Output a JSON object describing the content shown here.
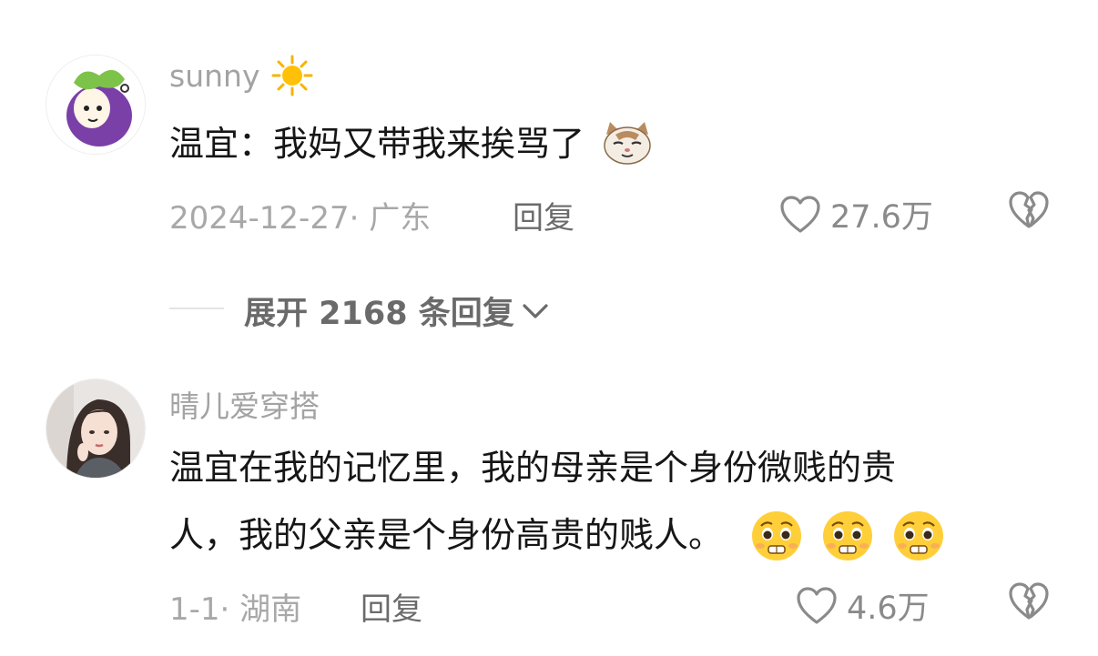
{
  "comments": [
    {
      "username": "sunny",
      "username_emoji": "sun-icon",
      "text": "温宜：我妈又带我来挨骂了",
      "text_emoji": "cat-face-icon",
      "date_location": "2024-12-27· 广东",
      "reply_label": "回复",
      "likes": "27.6万"
    },
    {
      "username": "晴儿爱穿搭",
      "text_line1": "温宜在我的记忆里，我的母亲是个身份微贱的贵",
      "text_line2": "人，我的父亲是个身份高贵的贱人。",
      "text_emoji": "pleading-face-icon",
      "text_emoji_count": 3,
      "date_location": "1-1· 湖南",
      "reply_label": "回复",
      "likes": "4.6万"
    }
  ],
  "expand_replies": "展开 2168 条回复",
  "colors": {
    "background": "#ffffff",
    "username": "#a3a3a3",
    "body": "#161616",
    "meta": "#a8a8a8",
    "reply": "#6b6b6b",
    "icon": "#8a8a8a"
  }
}
